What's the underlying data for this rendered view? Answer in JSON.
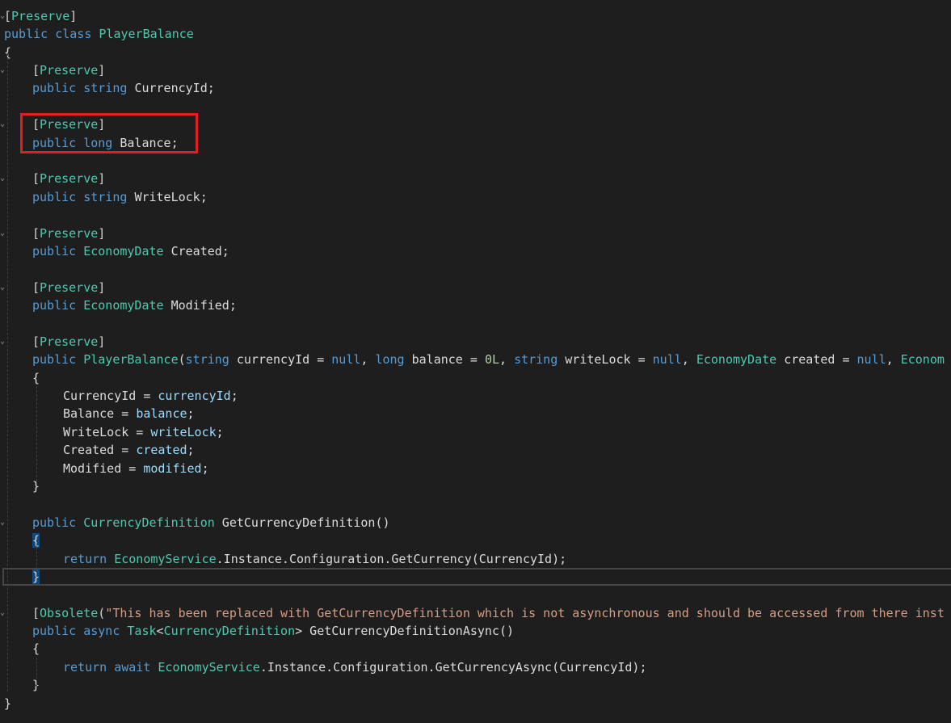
{
  "editor": {
    "lines": [
      {
        "fold": "⌄",
        "indent": 0,
        "tokens": [
          {
            "c": "br",
            "t": "["
          },
          {
            "c": "at",
            "t": "Preserve"
          },
          {
            "c": "br",
            "t": "]"
          }
        ]
      },
      {
        "fold": "",
        "indent": 0,
        "tokens": [
          {
            "c": "kw",
            "t": "public class "
          },
          {
            "c": "ty",
            "t": "PlayerBalance"
          }
        ]
      },
      {
        "fold": "",
        "indent": 0,
        "tokens": [
          {
            "c": "pl",
            "t": "{"
          }
        ]
      },
      {
        "fold": "⌄",
        "indent": 1,
        "tokens": [
          {
            "c": "br",
            "t": "["
          },
          {
            "c": "at",
            "t": "Preserve"
          },
          {
            "c": "br",
            "t": "]"
          }
        ]
      },
      {
        "fold": "",
        "indent": 1,
        "tokens": [
          {
            "c": "kw",
            "t": "public string "
          },
          {
            "c": "pl",
            "t": "CurrencyId;"
          }
        ]
      },
      {
        "fold": "",
        "indent": 1,
        "tokens": []
      },
      {
        "fold": "⌄",
        "indent": 1,
        "tokens": [
          {
            "c": "br",
            "t": "["
          },
          {
            "c": "at",
            "t": "Preserve"
          },
          {
            "c": "br",
            "t": "]"
          }
        ]
      },
      {
        "fold": "",
        "indent": 1,
        "tokens": [
          {
            "c": "kw",
            "t": "public long "
          },
          {
            "c": "pl",
            "t": "Balance;"
          }
        ]
      },
      {
        "fold": "",
        "indent": 1,
        "tokens": []
      },
      {
        "fold": "⌄",
        "indent": 1,
        "tokens": [
          {
            "c": "br",
            "t": "["
          },
          {
            "c": "at",
            "t": "Preserve"
          },
          {
            "c": "br",
            "t": "]"
          }
        ]
      },
      {
        "fold": "",
        "indent": 1,
        "tokens": [
          {
            "c": "kw",
            "t": "public string "
          },
          {
            "c": "pl",
            "t": "WriteLock;"
          }
        ]
      },
      {
        "fold": "",
        "indent": 1,
        "tokens": []
      },
      {
        "fold": "⌄",
        "indent": 1,
        "tokens": [
          {
            "c": "br",
            "t": "["
          },
          {
            "c": "at",
            "t": "Preserve"
          },
          {
            "c": "br",
            "t": "]"
          }
        ]
      },
      {
        "fold": "",
        "indent": 1,
        "tokens": [
          {
            "c": "kw",
            "t": "public "
          },
          {
            "c": "ty",
            "t": "EconomyDate"
          },
          {
            "c": "pl",
            "t": " Created;"
          }
        ]
      },
      {
        "fold": "",
        "indent": 1,
        "tokens": []
      },
      {
        "fold": "⌄",
        "indent": 1,
        "tokens": [
          {
            "c": "br",
            "t": "["
          },
          {
            "c": "at",
            "t": "Preserve"
          },
          {
            "c": "br",
            "t": "]"
          }
        ]
      },
      {
        "fold": "",
        "indent": 1,
        "tokens": [
          {
            "c": "kw",
            "t": "public "
          },
          {
            "c": "ty",
            "t": "EconomyDate"
          },
          {
            "c": "pl",
            "t": " Modified;"
          }
        ]
      },
      {
        "fold": "",
        "indent": 1,
        "tokens": []
      },
      {
        "fold": "⌄",
        "indent": 1,
        "tokens": [
          {
            "c": "br",
            "t": "["
          },
          {
            "c": "at",
            "t": "Preserve"
          },
          {
            "c": "br",
            "t": "]"
          }
        ]
      },
      {
        "fold": "",
        "indent": 1,
        "tokens": [
          {
            "c": "kw",
            "t": "public "
          },
          {
            "c": "ty",
            "t": "PlayerBalance"
          },
          {
            "c": "br",
            "t": "("
          },
          {
            "c": "kw",
            "t": "string"
          },
          {
            "c": "pl",
            "t": " currencyId = "
          },
          {
            "c": "kw",
            "t": "null"
          },
          {
            "c": "pl",
            "t": ", "
          },
          {
            "c": "kw",
            "t": "long"
          },
          {
            "c": "pl",
            "t": " balance = "
          },
          {
            "c": "nm",
            "t": "0L"
          },
          {
            "c": "pl",
            "t": ", "
          },
          {
            "c": "kw",
            "t": "string"
          },
          {
            "c": "pl",
            "t": " writeLock = "
          },
          {
            "c": "kw",
            "t": "null"
          },
          {
            "c": "pl",
            "t": ", "
          },
          {
            "c": "ty",
            "t": "EconomyDate"
          },
          {
            "c": "pl",
            "t": " created = "
          },
          {
            "c": "kw",
            "t": "null"
          },
          {
            "c": "pl",
            "t": ", "
          },
          {
            "c": "ty",
            "t": "Econom"
          }
        ]
      },
      {
        "fold": "",
        "indent": 1,
        "tokens": [
          {
            "c": "pl",
            "t": "{"
          }
        ]
      },
      {
        "fold": "",
        "indent": 2,
        "tokens": [
          {
            "c": "pl",
            "t": "CurrencyId = "
          },
          {
            "c": "pm",
            "t": "currencyId"
          },
          {
            "c": "pl",
            "t": ";"
          }
        ]
      },
      {
        "fold": "",
        "indent": 2,
        "tokens": [
          {
            "c": "pl",
            "t": "Balance = "
          },
          {
            "c": "pm",
            "t": "balance"
          },
          {
            "c": "pl",
            "t": ";"
          }
        ]
      },
      {
        "fold": "",
        "indent": 2,
        "tokens": [
          {
            "c": "pl",
            "t": "WriteLock = "
          },
          {
            "c": "pm",
            "t": "writeLock"
          },
          {
            "c": "pl",
            "t": ";"
          }
        ]
      },
      {
        "fold": "",
        "indent": 2,
        "tokens": [
          {
            "c": "pl",
            "t": "Created = "
          },
          {
            "c": "pm",
            "t": "created"
          },
          {
            "c": "pl",
            "t": ";"
          }
        ]
      },
      {
        "fold": "",
        "indent": 2,
        "tokens": [
          {
            "c": "pl",
            "t": "Modified = "
          },
          {
            "c": "pm",
            "t": "modified"
          },
          {
            "c": "pl",
            "t": ";"
          }
        ]
      },
      {
        "fold": "",
        "indent": 1,
        "tokens": [
          {
            "c": "pl",
            "t": "}"
          }
        ]
      },
      {
        "fold": "",
        "indent": 1,
        "tokens": []
      },
      {
        "fold": "⌄",
        "indent": 1,
        "tokens": [
          {
            "c": "kw",
            "t": "public "
          },
          {
            "c": "ty",
            "t": "CurrencyDefinition"
          },
          {
            "c": "pl",
            "t": " GetCurrencyDefinition()"
          }
        ]
      },
      {
        "fold": "",
        "indent": 1,
        "tokens": [
          {
            "c": "pl brace-hl",
            "t": "{"
          }
        ]
      },
      {
        "fold": "",
        "indent": 2,
        "tokens": [
          {
            "c": "kw",
            "t": "return "
          },
          {
            "c": "ty",
            "t": "EconomyService"
          },
          {
            "c": "pl",
            "t": ".Instance.Configuration.GetCurrency(CurrencyId);"
          }
        ]
      },
      {
        "fold": "",
        "indent": 1,
        "tokens": [
          {
            "c": "pl brace-hl",
            "t": "}"
          }
        ]
      },
      {
        "fold": "",
        "indent": 1,
        "tokens": []
      },
      {
        "fold": "⌄",
        "indent": 1,
        "tokens": [
          {
            "c": "br",
            "t": "["
          },
          {
            "c": "at",
            "t": "Obsolete"
          },
          {
            "c": "br",
            "t": "("
          },
          {
            "c": "str",
            "t": "\"This has been replaced with GetCurrencyDefinition which is not asynchronous and should be accessed from there inst"
          }
        ]
      },
      {
        "fold": "",
        "indent": 1,
        "tokens": [
          {
            "c": "kw",
            "t": "public async "
          },
          {
            "c": "ty",
            "t": "Task"
          },
          {
            "c": "pl",
            "t": "<"
          },
          {
            "c": "ty",
            "t": "CurrencyDefinition"
          },
          {
            "c": "pl",
            "t": "> GetCurrencyDefinitionAsync()"
          }
        ]
      },
      {
        "fold": "",
        "indent": 1,
        "tokens": [
          {
            "c": "pl",
            "t": "{"
          }
        ]
      },
      {
        "fold": "",
        "indent": 2,
        "tokens": [
          {
            "c": "kw",
            "t": "return await "
          },
          {
            "c": "ty",
            "t": "EconomyService"
          },
          {
            "c": "pl",
            "t": ".Instance.Configuration.GetCurrencyAsync(CurrencyId);"
          }
        ]
      },
      {
        "fold": "",
        "indent": 1,
        "tokens": [
          {
            "c": "pl",
            "t": "}"
          }
        ]
      },
      {
        "fold": "",
        "indent": 0,
        "tokens": [
          {
            "c": "pl",
            "t": "}"
          }
        ]
      }
    ]
  }
}
